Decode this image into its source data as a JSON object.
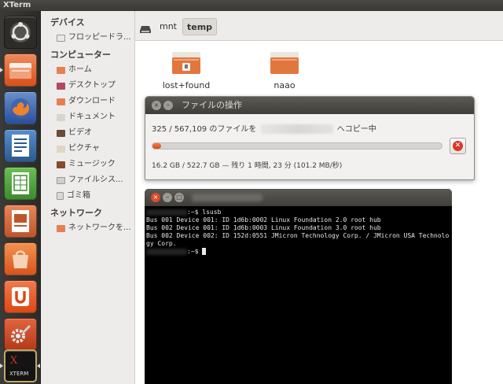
{
  "window_title": "XTerm",
  "launcher": {
    "items": [
      {
        "name": "dash-home-icon",
        "color": "#3a3935"
      },
      {
        "name": "files-icon",
        "color": "#dd4814"
      },
      {
        "name": "firefox-icon",
        "color": "#e66000"
      },
      {
        "name": "writer-icon",
        "color": "#2c5a8c"
      },
      {
        "name": "calc-icon",
        "color": "#3d8b2e"
      },
      {
        "name": "impress-icon",
        "color": "#c0552a"
      },
      {
        "name": "software-center-icon",
        "color": "#e7662c"
      },
      {
        "name": "ubuntu-one-icon",
        "color": "#dd4814"
      },
      {
        "name": "system-settings-icon",
        "color": "#c4401a"
      },
      {
        "name": "xterm-icon",
        "color": "#1c1c1c"
      }
    ],
    "xterm_label": "XTERM",
    "xterm_x": "X"
  },
  "sidebar": {
    "devices_heading": "デバイス",
    "devices": [
      {
        "label": "フロッピードラ..."
      }
    ],
    "computer_heading": "コンピューター",
    "computer": [
      {
        "label": "ホーム"
      },
      {
        "label": "デスクトップ"
      },
      {
        "label": "ダウンロード"
      },
      {
        "label": "ドキュメント"
      },
      {
        "label": "ビデオ"
      },
      {
        "label": "ピクチャ"
      },
      {
        "label": "ミュージック"
      },
      {
        "label": "ファイルシス..."
      },
      {
        "label": "ゴミ箱"
      }
    ],
    "network_heading": "ネットワーク",
    "network": [
      {
        "label": "ネットワークを..."
      }
    ]
  },
  "pathbar": {
    "items": [
      {
        "label": "mnt"
      },
      {
        "label": "temp"
      }
    ]
  },
  "folders": [
    {
      "label": "lost+found"
    },
    {
      "label": "naao"
    }
  ],
  "dialog": {
    "title": "ファイルの操作",
    "copy_text_prefix": "325 / 567,109 のファイルを",
    "copy_text_suffix": "へコピー中",
    "progress": 0.02,
    "status": "16.2 GB / 522.7 GB — 残り 1 時間, 23 分 (101.2 MB/秒)",
    "accent": "#dd4814"
  },
  "terminal": {
    "prompt_suffix": ":~$",
    "command": "lsusb",
    "output": [
      "Bus 001 Device 001: ID 1d6b:0002 Linux Foundation 2.0 root hub",
      "Bus 002 Device 001: ID 1d6b:0003 Linux Foundation 3.0 root hub",
      "Bus 002 Device 002: ID 152d:0551 JMicron Technology Corp. / JMicron USA Technolo",
      "gy Corp."
    ]
  }
}
